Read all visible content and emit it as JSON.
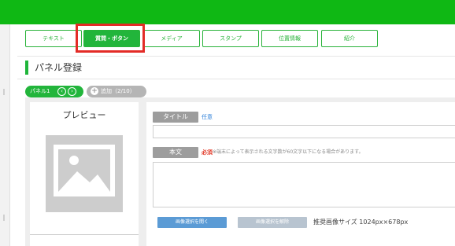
{
  "colors": {
    "brand_green": "#0fb814",
    "tab_green": "#22b53b",
    "highlight_red": "#e32b26",
    "link_blue": "#2c7fd8",
    "required_red": "#e23b2a"
  },
  "tabs": [
    {
      "label": "テキスト",
      "active": false
    },
    {
      "label": "質問・ボタン",
      "active": true
    },
    {
      "label": "メディア",
      "active": false
    },
    {
      "label": "スタンプ",
      "active": false
    },
    {
      "label": "位置情報",
      "active": false
    },
    {
      "label": "紹介",
      "active": false
    }
  ],
  "section_title": "パネル登録",
  "panel_tab": {
    "label": "パネル1",
    "prev_icon": "chevron-left-icon",
    "next_icon": "chevron-right-icon"
  },
  "add_panel": {
    "label": "追加（2/10）",
    "icon": "plus-icon"
  },
  "preview": {
    "label": "プレビュー",
    "image_icon": "image-placeholder-icon"
  },
  "form": {
    "title_label": "タイトル",
    "title_optional": "任意",
    "body_label": "本文",
    "body_required": "必須",
    "body_note": "※端末によって表示される文字数が60文字以下になる場合があります。",
    "select_image_button": "画像選択を開く",
    "clear_image_button": "画像選択を解除",
    "recommended_size": "推奨画像サイズ 1024px×678px"
  }
}
